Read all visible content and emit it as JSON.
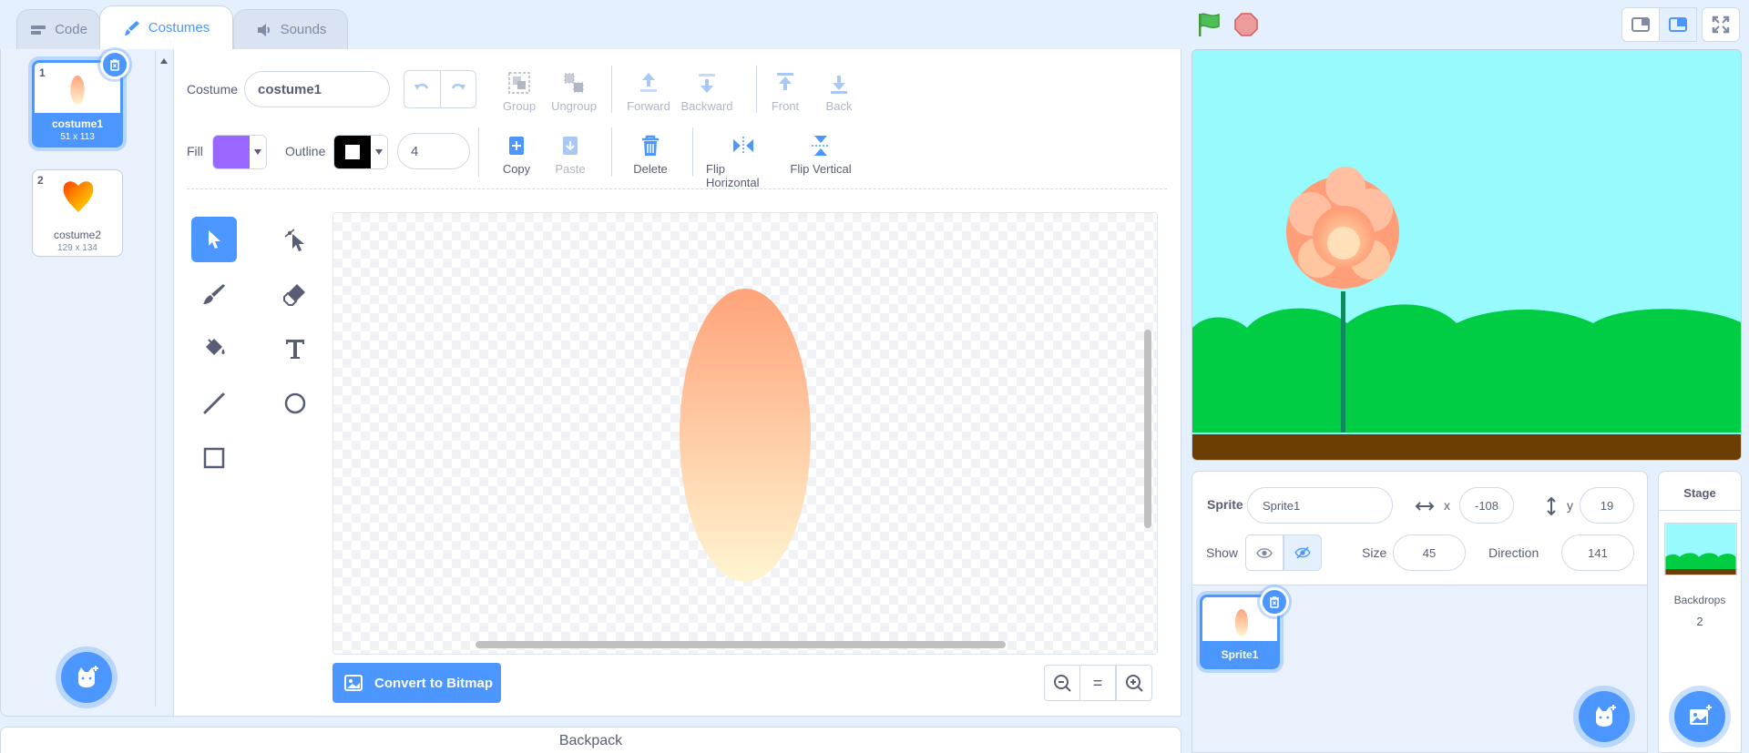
{
  "tabs": [
    {
      "label": "Code",
      "icon": "code-icon"
    },
    {
      "label": "Costumes",
      "icon": "brush-icon"
    },
    {
      "label": "Sounds",
      "icon": "speaker-icon"
    }
  ],
  "costumes": [
    {
      "number": "1",
      "name": "costume1",
      "size": "51 x 113"
    },
    {
      "number": "2",
      "name": "costume2",
      "size": "129 x 134"
    }
  ],
  "editor": {
    "costume_label": "Costume",
    "costume_name": "costume1",
    "fill_label": "Fill",
    "fill_color": "#9966ff",
    "outline_label": "Outline",
    "outline_color": "#000000",
    "outline_width": "4",
    "toolbar_row1": [
      "Group",
      "Ungroup",
      "Forward",
      "Backward",
      "Front",
      "Back"
    ],
    "toolbar_row2": [
      "Copy",
      "Paste",
      "Delete",
      "Flip Horizontal",
      "Flip Vertical"
    ],
    "convert_label": "Convert to Bitmap",
    "zoom_reset": "="
  },
  "backpack_label": "Backpack",
  "sprite_info": {
    "sprite_label": "Sprite",
    "sprite_name": "Sprite1",
    "x_label": "x",
    "x_value": "-108",
    "y_label": "y",
    "y_value": "19",
    "show_label": "Show",
    "size_label": "Size",
    "size_value": "45",
    "direction_label": "Direction",
    "direction_value": "141"
  },
  "sprites": [
    {
      "name": "Sprite1"
    }
  ],
  "stage_pane": {
    "title": "Stage",
    "backdrops_label": "Backdrops",
    "backdrops_count": "2"
  },
  "colors": {
    "accent": "#4c97ff",
    "stage_sky": "#97fbfd",
    "hills": "#00cc44",
    "ground": "#6b3e04"
  }
}
